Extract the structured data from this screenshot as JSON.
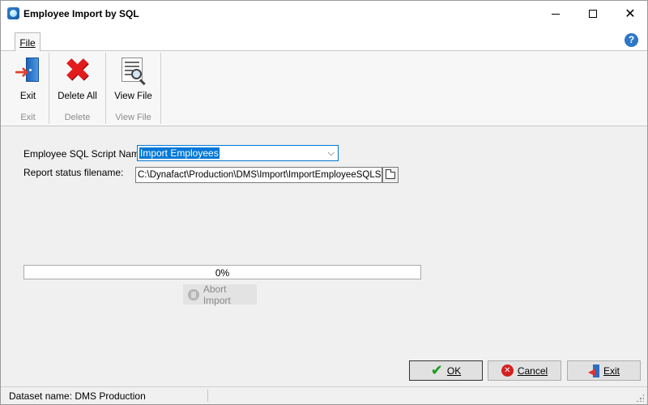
{
  "window": {
    "title": "Employee Import by SQL",
    "controls": {
      "minimize": "minimize",
      "maximize": "maximize",
      "close": "close"
    }
  },
  "ribbon": {
    "tab_file": "File",
    "help": "?",
    "groups": [
      {
        "button_label": "Exit",
        "group_label": "Exit",
        "icon": "exit-door-icon"
      },
      {
        "button_label": "Delete All",
        "group_label": "Delete",
        "icon": "delete-x-icon"
      },
      {
        "button_label": "View File",
        "group_label": "View File",
        "icon": "view-file-icon"
      }
    ]
  },
  "form": {
    "script_label": "Employee SQL Script Name:",
    "script_value": "Import Employees",
    "status_label": "Report status filename:",
    "status_value": "C:\\Dynafact\\Production\\DMS\\Import\\ImportEmployeeSQLStat"
  },
  "progress": {
    "percent": 0,
    "text": "0%"
  },
  "abort_label": "Abort Import",
  "buttons": {
    "ok": "OK",
    "cancel": "Cancel",
    "exit": "Exit"
  },
  "statusbar": {
    "dataset": "Dataset name:  DMS Production"
  },
  "colors": {
    "accent": "#0078d7",
    "delete_red": "#e21c1c",
    "ok_green": "#1a9b1a"
  }
}
